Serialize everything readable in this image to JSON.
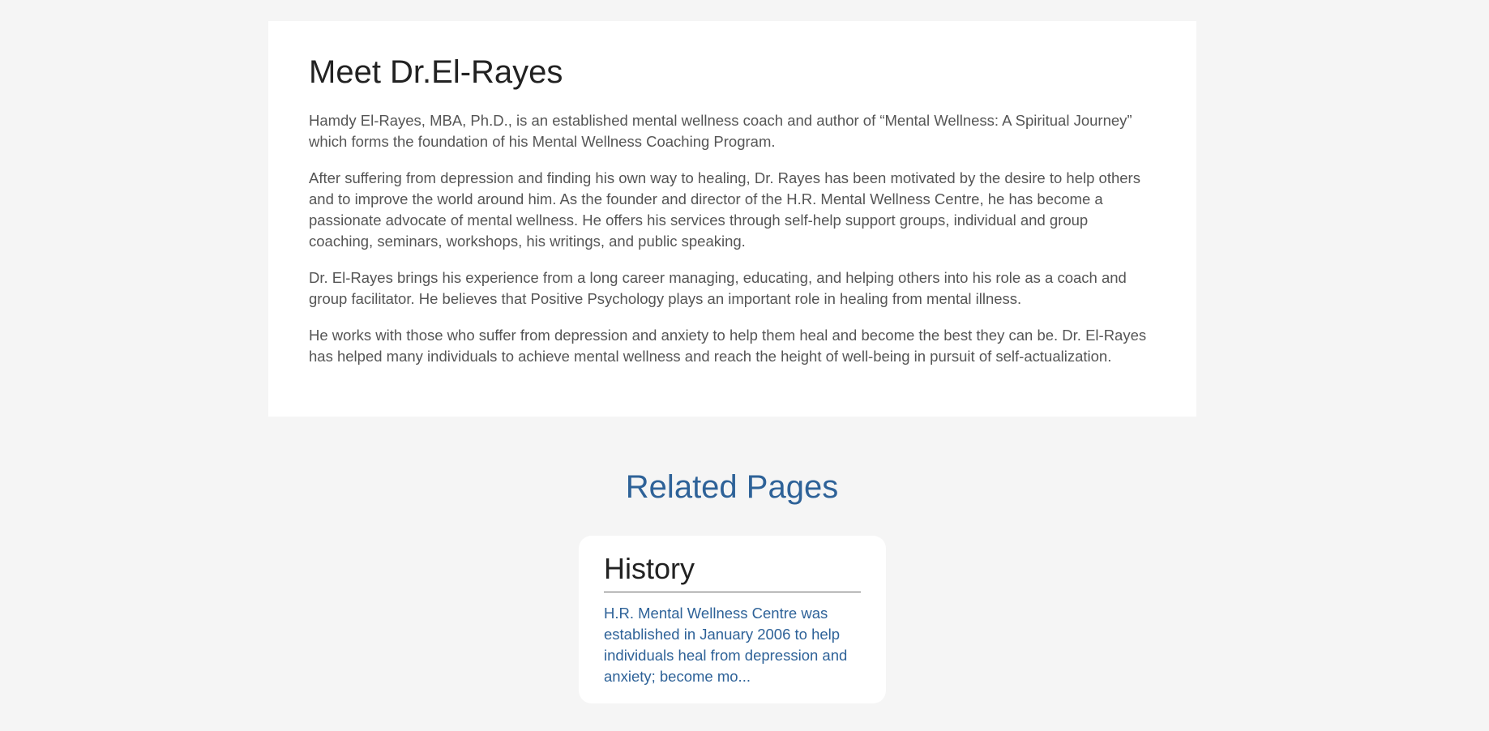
{
  "bio": {
    "title": "Meet Dr.El-Rayes",
    "paragraphs": [
      "Hamdy El-Rayes, MBA, Ph.D., is an established mental wellness coach and author of “Mental Wellness: A Spiritual Journey” which forms the foundation of his Mental Wellness Coaching Program.",
      "After suffering from depression and finding his own way to healing, Dr. Rayes has been motivated by the desire to help others and to improve the world around him. As the founder and director of the H.R. Mental Wellness Centre, he has become a passionate advocate of mental wellness. He offers his services through self-help support groups, individual and group coaching, seminars, workshops, his writings, and public speaking.",
      "Dr. El-Rayes brings his experience from a long career managing, educating, and helping others into his role as a coach and group facilitator. He believes that Positive Psychology plays an important role in healing from mental illness.",
      "He works with those who suffer from depression and anxiety to help them heal and become the best they can be. Dr. El-Rayes has helped many individuals to achieve mental wellness and reach the height of well-being in pursuit of self-actualization."
    ]
  },
  "related": {
    "heading": "Related Pages",
    "cards": [
      {
        "title": "History",
        "excerpt": "H.R. Mental Wellness Centre was established in January 2006 to help individuals heal from depression and anxiety; become mo..."
      }
    ]
  },
  "colors": {
    "background": "#f5f5f5",
    "card": "#ffffff",
    "accent": "#2e6298",
    "heading_text": "#222222",
    "body_text": "#555555"
  }
}
